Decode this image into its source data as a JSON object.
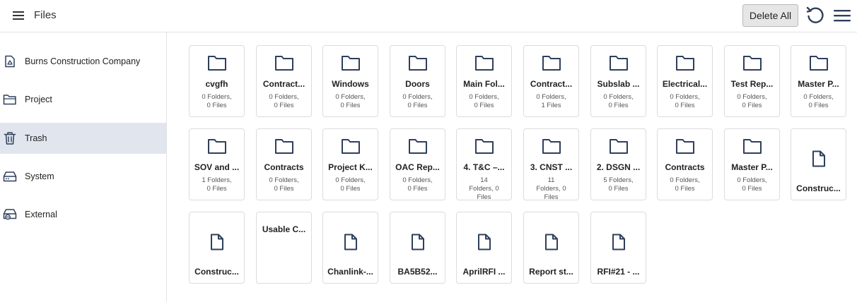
{
  "header": {
    "title": "Files",
    "delete_all_label": "Delete All"
  },
  "sidebar": {
    "items": [
      {
        "label": "Burns Construction Company",
        "icon": "building-icon",
        "active": false
      },
      {
        "label": "Project",
        "icon": "folder-open-icon",
        "active": false
      },
      {
        "label": "Trash",
        "icon": "trash-icon",
        "active": true
      },
      {
        "label": "System",
        "icon": "hard-drive-icon",
        "active": false
      },
      {
        "label": "External",
        "icon": "external-drive-icon",
        "active": false
      }
    ]
  },
  "grid": {
    "items": [
      {
        "type": "folder",
        "name": "cvgfh",
        "sub1": "0 Folders,",
        "sub2": "0 Files"
      },
      {
        "type": "folder",
        "name": "Contract...",
        "sub1": "0 Folders,",
        "sub2": "0 Files"
      },
      {
        "type": "folder",
        "name": "Windows",
        "sub1": "0 Folders,",
        "sub2": "0 Files"
      },
      {
        "type": "folder",
        "name": "Doors",
        "sub1": "0 Folders,",
        "sub2": "0 Files"
      },
      {
        "type": "folder",
        "name": "Main Fol...",
        "sub1": "0 Folders,",
        "sub2": "0 Files"
      },
      {
        "type": "folder",
        "name": "Contract...",
        "sub1": "0 Folders,",
        "sub2": "1 Files"
      },
      {
        "type": "folder",
        "name": "Subslab ...",
        "sub1": "0 Folders,",
        "sub2": "0 Files"
      },
      {
        "type": "folder",
        "name": "Electrical...",
        "sub1": "0 Folders,",
        "sub2": "0 Files"
      },
      {
        "type": "folder",
        "name": "Test Rep...",
        "sub1": "0 Folders,",
        "sub2": "0 Files"
      },
      {
        "type": "folder",
        "name": "Master P...",
        "sub1": "0 Folders,",
        "sub2": "0 Files"
      },
      {
        "type": "folder",
        "name": "SOV and ...",
        "sub1": "1 Folders,",
        "sub2": "0 Files"
      },
      {
        "type": "folder",
        "name": "Contracts",
        "sub1": "0 Folders,",
        "sub2": "0 Files"
      },
      {
        "type": "folder",
        "name": "Project K...",
        "sub1": "0 Folders,",
        "sub2": "0 Files"
      },
      {
        "type": "folder",
        "name": "OAC Rep...",
        "sub1": "0 Folders,",
        "sub2": "0 Files"
      },
      {
        "type": "folder",
        "name": "4. T&C –...",
        "sub1": "14",
        "sub2": "Folders, 0",
        "sub3": "Files"
      },
      {
        "type": "folder",
        "name": "3. CNST ...",
        "sub1": "11",
        "sub2": "Folders, 0",
        "sub3": "Files"
      },
      {
        "type": "folder",
        "name": "2. DSGN ...",
        "sub1": "5 Folders,",
        "sub2": "0 Files"
      },
      {
        "type": "folder",
        "name": "Contracts",
        "sub1": "0 Folders,",
        "sub2": "0 Files"
      },
      {
        "type": "folder",
        "name": "Master P...",
        "sub1": "0 Folders,",
        "sub2": "0 Files"
      },
      {
        "type": "file",
        "name": "Construc..."
      },
      {
        "type": "file",
        "name": "Construc..."
      },
      {
        "type": "noicon",
        "name": "Usable C..."
      },
      {
        "type": "file",
        "name": "Chanlink-..."
      },
      {
        "type": "file",
        "name": "BA5B52..."
      },
      {
        "type": "file",
        "name": "AprilRFI ..."
      },
      {
        "type": "file",
        "name": "Report st..."
      },
      {
        "type": "file",
        "name": "RFI#21 - ..."
      }
    ]
  },
  "colors": {
    "icon": "#2f3f5c",
    "active_bg": "#e1e6ee",
    "border": "#dcdcdc"
  }
}
